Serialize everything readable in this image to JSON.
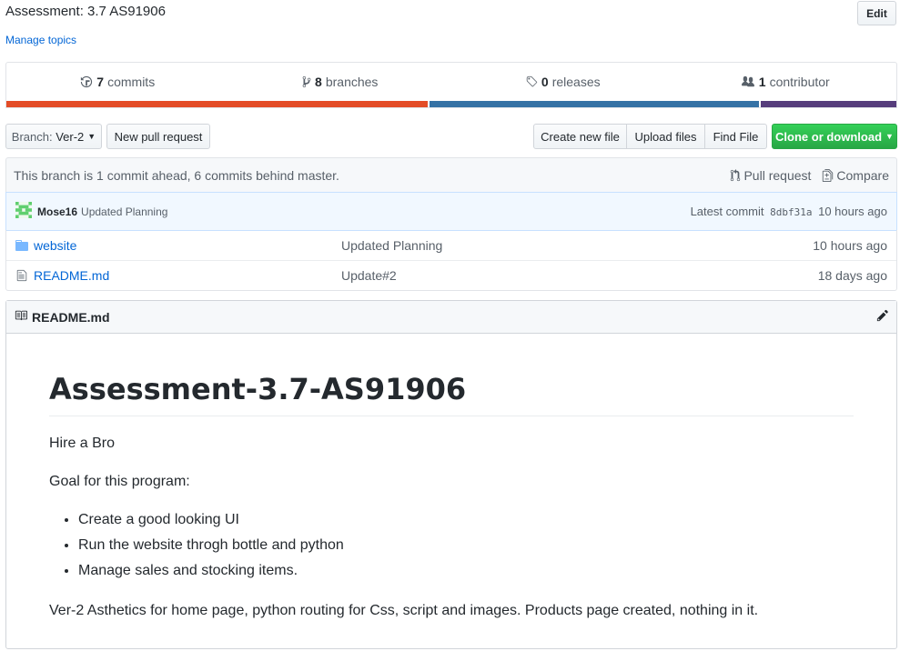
{
  "repo": {
    "description": "Assessment: 3.7 AS91906",
    "edit_label": "Edit",
    "manage_topics": "Manage topics"
  },
  "summary": {
    "commits_count": "7",
    "commits_label": "commits",
    "branches_count": "8",
    "branches_label": "branches",
    "releases_count": "0",
    "releases_label": "releases",
    "contributors_count": "1",
    "contributors_label": "contributor",
    "language_bar": [
      {
        "color": "#e34c26",
        "percent": 47.5
      },
      {
        "color": "#3572a5",
        "percent": 37.3
      },
      {
        "color": "#563d7c",
        "percent": 15.2
      }
    ]
  },
  "toolbar": {
    "branch_prefix": "Branch:",
    "branch_name": "Ver-2",
    "new_pull_request": "New pull request",
    "create_new_file": "Create new file",
    "upload_files": "Upload files",
    "find_file": "Find File",
    "clone_or_download": "Clone or download"
  },
  "branch_info": {
    "status": "This branch is 1 commit ahead, 6 commits behind master.",
    "pull_request": "Pull request",
    "compare": "Compare"
  },
  "latest_commit": {
    "author": "Mose16",
    "message": "Updated Planning",
    "latest_label": "Latest commit",
    "sha": "8dbf31a",
    "age": "10 hours ago"
  },
  "files": [
    {
      "type": "folder",
      "name": "website",
      "message": "Updated Planning",
      "age": "10 hours ago"
    },
    {
      "type": "file",
      "name": "README.md",
      "message": "Update#2",
      "age": "18 days ago"
    }
  ],
  "readme": {
    "header": "README.md",
    "title": "Assessment-3.7-AS91906",
    "p1": "Hire a Bro",
    "p2": "Goal for this program:",
    "bullets": [
      "Create a good looking UI",
      "Run the website throgh bottle and python",
      "Manage sales and stocking items."
    ],
    "p3": "Ver-2 Asthetics for home page, python routing for Css, script and images. Products page created, nothing in it."
  }
}
